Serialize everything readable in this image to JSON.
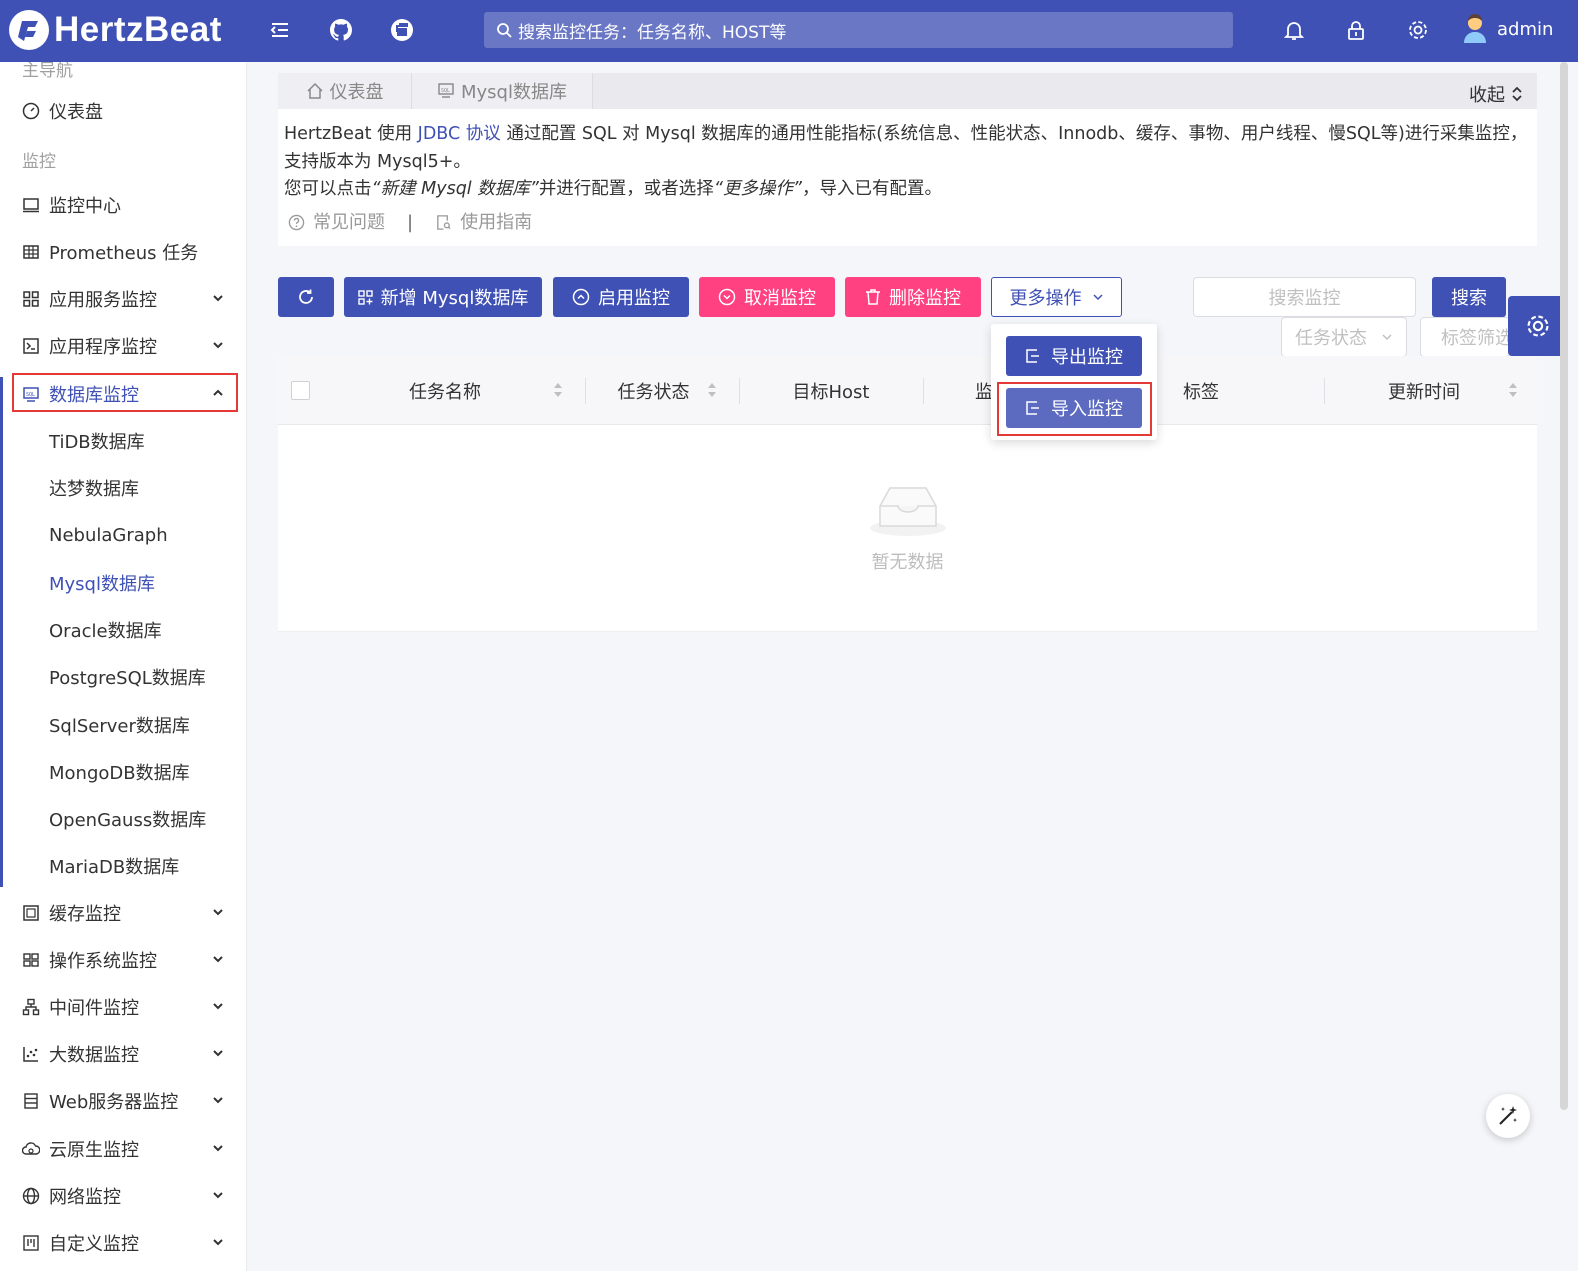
{
  "header": {
    "logo_text": "HertzBeat",
    "search_placeholder": "搜索监控任务：任务名称、HOST等",
    "username": "admin",
    "icons": [
      "menu-fold-icon",
      "github-icon",
      "gitee-icon",
      "bell-icon",
      "lock-icon",
      "gear-icon",
      "user-avatar-icon"
    ]
  },
  "sidebar": {
    "cut_group": "主导航",
    "dashboard": "仪表盘",
    "group_monitor": "监控",
    "items": [
      {
        "label": "监控中心",
        "icon": "monitor-icon"
      },
      {
        "label": "Prometheus 任务",
        "icon": "table-icon"
      },
      {
        "label": "应用服务监控",
        "icon": "appstore-icon"
      },
      {
        "label": "应用程序监控",
        "icon": "code-icon"
      },
      {
        "label": "数据库监控",
        "icon": "database-icon"
      }
    ],
    "db_sub": [
      "TiDB数据库",
      "达梦数据库",
      "NebulaGraph",
      "Mysql数据库",
      "Oracle数据库",
      "PostgreSQL数据库",
      "SqlServer数据库",
      "MongoDB数据库",
      "OpenGauss数据库",
      "MariaDB数据库"
    ],
    "bottom_items": [
      {
        "label": "缓存监控",
        "icon": "container-icon"
      },
      {
        "label": "操作系统监控",
        "icon": "windows-icon"
      },
      {
        "label": "中间件监控",
        "icon": "cluster-icon"
      },
      {
        "label": "大数据监控",
        "icon": "dot-chart-icon"
      },
      {
        "label": "Web服务器监控",
        "icon": "server-icon"
      },
      {
        "label": "云原生监控",
        "icon": "cloud-icon"
      },
      {
        "label": "网络监控",
        "icon": "global-icon"
      },
      {
        "label": "自定义监控",
        "icon": "project-icon"
      }
    ]
  },
  "tabs": {
    "dashboard": "仪表盘",
    "mysql": "Mysql数据库",
    "collapse": "收起"
  },
  "info": {
    "line1_a": "HertzBeat 使用 ",
    "line1_link": "JDBC 协议",
    "line1_b": " 通过配置 SQL 对 Mysql 数据库的通用性能指标(系统信息、性能状态、Innodb、缓存、事物、用户线程、慢SQL等)进行采集监控，支持版本为 Mysql5+。",
    "line2_a": "您可以点击",
    "line2_i1": "“新建 Mysql 数据库”",
    "line2_b": "并进行配置，或者选择",
    "line2_i2": "“更多操作”",
    "line2_c": "，导入已有配置。",
    "faq": "常见问题",
    "sep": "|",
    "guide": "使用指南"
  },
  "toolbar": {
    "new": "新增 Mysql数据库",
    "enable": "启用监控",
    "cancel": "取消监控",
    "delete": "删除监控",
    "more": "更多操作",
    "search_placeholder": "搜索监控",
    "search": "搜索",
    "status_filter": "任务状态",
    "tag_filter": "标签筛选"
  },
  "dropdown": {
    "export": "导出监控",
    "import": "导入监控"
  },
  "table": {
    "columns": [
      "任务名称",
      "任务状态",
      "目标Host",
      "监控",
      "标签",
      "更新时间"
    ],
    "empty": "暂无数据"
  },
  "colors": {
    "primary": "#3f51b5",
    "danger": "#ff4081",
    "highlight_box": "#e53935"
  }
}
